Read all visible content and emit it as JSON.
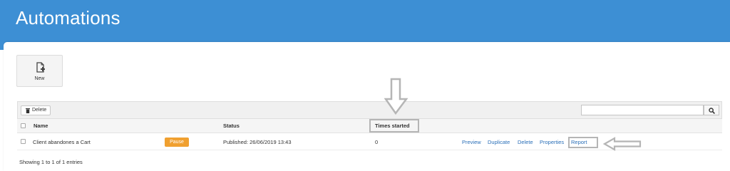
{
  "app": {
    "title": "Automations"
  },
  "toolbar": {
    "new_label": "New"
  },
  "table_controls": {
    "delete_label": "Delete",
    "search_placeholder": "",
    "search_value": ""
  },
  "table": {
    "columns": {
      "name": "Name",
      "status": "Status",
      "times_started": "Times started"
    },
    "rows": [
      {
        "name": "Client abandones a Cart",
        "badge": "Pause",
        "status": "Published: 26/06/2019 13:43",
        "times_started": "0",
        "actions": [
          "Preview",
          "Duplicate",
          "Delete",
          "Properties",
          "Report"
        ]
      }
    ]
  },
  "footer": {
    "info": "Showing 1 to 1 of 1 entries"
  },
  "colors": {
    "header_bar": "#3d8fd4",
    "pause_badge": "#f0a030",
    "link": "#2a6fb8",
    "annotation": "#b5b5b5"
  },
  "icons": {
    "new": "new-document-icon",
    "delete": "trash-icon",
    "search": "magnifier-icon",
    "annotation_down": "down-arrow-annotation-icon",
    "annotation_left": "left-arrow-annotation-icon"
  }
}
